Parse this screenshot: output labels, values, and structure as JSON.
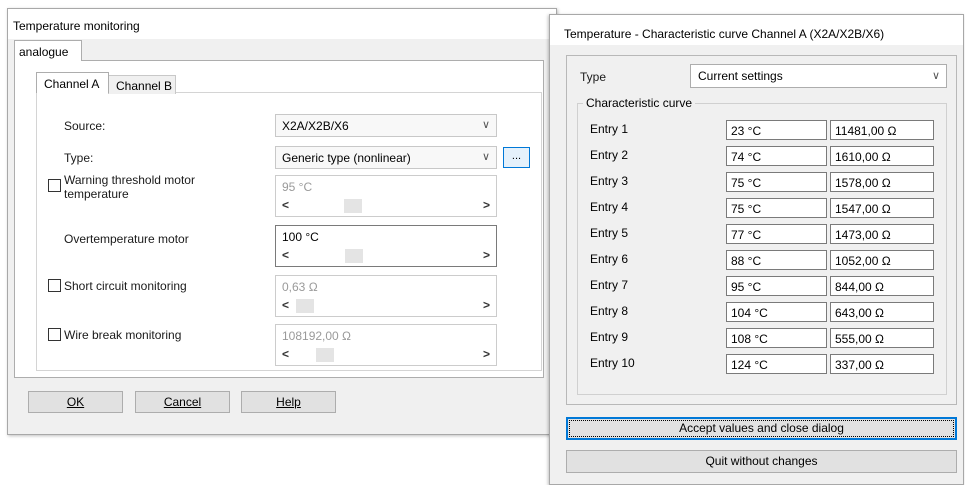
{
  "left_dialog": {
    "title": "Temperature monitoring",
    "outer_tab": "analogue",
    "tabs": [
      "Channel A",
      "Channel B"
    ],
    "source": {
      "label": "Source:",
      "value": "X2A/X2B/X6"
    },
    "type": {
      "label": "Type:",
      "value": "Generic type (nonlinear)",
      "button": "..."
    },
    "warning": {
      "label_line1": "Warning threshold motor",
      "label_line2": "temperature",
      "value": "95 °C",
      "checked": false
    },
    "overtemp": {
      "label": "Overtemperature motor",
      "value": "100 °C"
    },
    "short_circuit": {
      "label": "Short circuit monitoring",
      "value": "0,63 Ω",
      "checked": false
    },
    "wire_break": {
      "label": "Wire break monitoring",
      "value": "108192,00 Ω",
      "checked": false
    },
    "buttons": {
      "ok": "OK",
      "cancel": "Cancel",
      "help": "Help"
    },
    "arrows": {
      "left": "<",
      "right": ">",
      "down": "∨"
    }
  },
  "right_dialog": {
    "title": "Temperature - Characteristic curve Channel A (X2A/X2B/X6)",
    "type_label": "Type",
    "type_value": "Current settings",
    "group_title": "Characteristic curve",
    "entries": [
      {
        "label": "Entry 1",
        "temp": "23 °C",
        "res": "11481,00 Ω"
      },
      {
        "label": "Entry 2",
        "temp": "74 °C",
        "res": "1610,00 Ω"
      },
      {
        "label": "Entry 3",
        "temp": "75 °C",
        "res": "1578,00 Ω"
      },
      {
        "label": "Entry 4",
        "temp": "75 °C",
        "res": "1547,00 Ω"
      },
      {
        "label": "Entry 5",
        "temp": "77 °C",
        "res": "1473,00 Ω"
      },
      {
        "label": "Entry 6",
        "temp": "88 °C",
        "res": "1052,00 Ω"
      },
      {
        "label": "Entry 7",
        "temp": "95 °C",
        "res": "844,00 Ω"
      },
      {
        "label": "Entry 8",
        "temp": "104 °C",
        "res": "643,00 Ω"
      },
      {
        "label": "Entry 9",
        "temp": "108 °C",
        "res": "555,00 Ω"
      },
      {
        "label": "Entry 10",
        "temp": "124 °C",
        "res": "337,00 Ω"
      }
    ],
    "accept_button": "Accept values and close dialog",
    "quit_button": "Quit without changes"
  }
}
